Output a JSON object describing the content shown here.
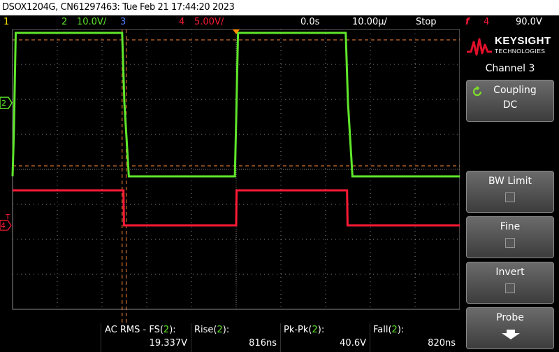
{
  "window_title": "DSOX1204G, CN61297463: Tue Feb 21 17:44:20 2023",
  "status_bar": {
    "ch1_num": "1",
    "ch2_num": "2",
    "ch2_scale": "10.0V/",
    "ch3_num": "3",
    "ch4_num": "4",
    "ch4_scale": "5.00V/",
    "time_offset": "0.0s",
    "time_scale": "10.00µ/",
    "run_state": "Stop",
    "trigger_symbol": "f",
    "trigger_source": "4",
    "trigger_level": "90.0V"
  },
  "colors": {
    "ch1": "#f5e000",
    "ch2": "#5fe62a",
    "ch3": "#4f7fff",
    "ch4": "#ff1a35",
    "cursor": "#ff8a3a",
    "grid": "#8a8a8a",
    "trigger_marker": "#ff8c00"
  },
  "side_markers": {
    "ch2_label": "2",
    "ch4_label": "4",
    "trigger_label": "T"
  },
  "logo": {
    "brand": "KEYSIGHT",
    "sub": "TECHNOLOGIES"
  },
  "softkey_panel": {
    "title": "Channel 3",
    "coupling_label": "Coupling",
    "coupling_value": "DC",
    "bw_limit_label": "BW Limit",
    "fine_label": "Fine",
    "invert_label": "Invert",
    "probe_label": "Probe"
  },
  "measurements": [
    {
      "label_pre": "AC RMS - FS(",
      "source": "2",
      "label_post": "):",
      "value": "19.337V"
    },
    {
      "label_pre": "Rise(",
      "source": "2",
      "label_post": "):",
      "value": "816ns"
    },
    {
      "label_pre": "Pk-Pk(",
      "source": "2",
      "label_post": "):",
      "value": "40.6V"
    },
    {
      "label_pre": "Fall(",
      "source": "2",
      "label_post": "):",
      "value": "820ns"
    }
  ],
  "chart_data": {
    "type": "line",
    "x_unit": "s",
    "time_per_div": "10.00µs",
    "divisions_x": 10,
    "divisions_y": 8,
    "grid": true,
    "series": [
      {
        "name": "2",
        "x_us": [
          -50,
          -49.7,
          -49.3,
          -49.1,
          -25.5,
          -25.0,
          -24.0,
          -0.3,
          0.0,
          0.4,
          0.6,
          24.5,
          25.0,
          26.0,
          50
        ],
        "volts": [
          -21.0,
          -8.0,
          20.0,
          20.0,
          20.0,
          0.0,
          -21.0,
          -21.0,
          -5.0,
          20.0,
          20.0,
          20.0,
          0.0,
          -21.0,
          -21.0
        ]
      },
      {
        "name": "4",
        "x_us": [
          -50,
          -25.2,
          -25.1,
          0.0,
          0.1,
          24.8,
          24.9,
          50
        ],
        "volts": [
          5.0,
          5.0,
          0.0,
          0.0,
          5.0,
          5.0,
          0.0,
          0.0
        ]
      }
    ]
  }
}
